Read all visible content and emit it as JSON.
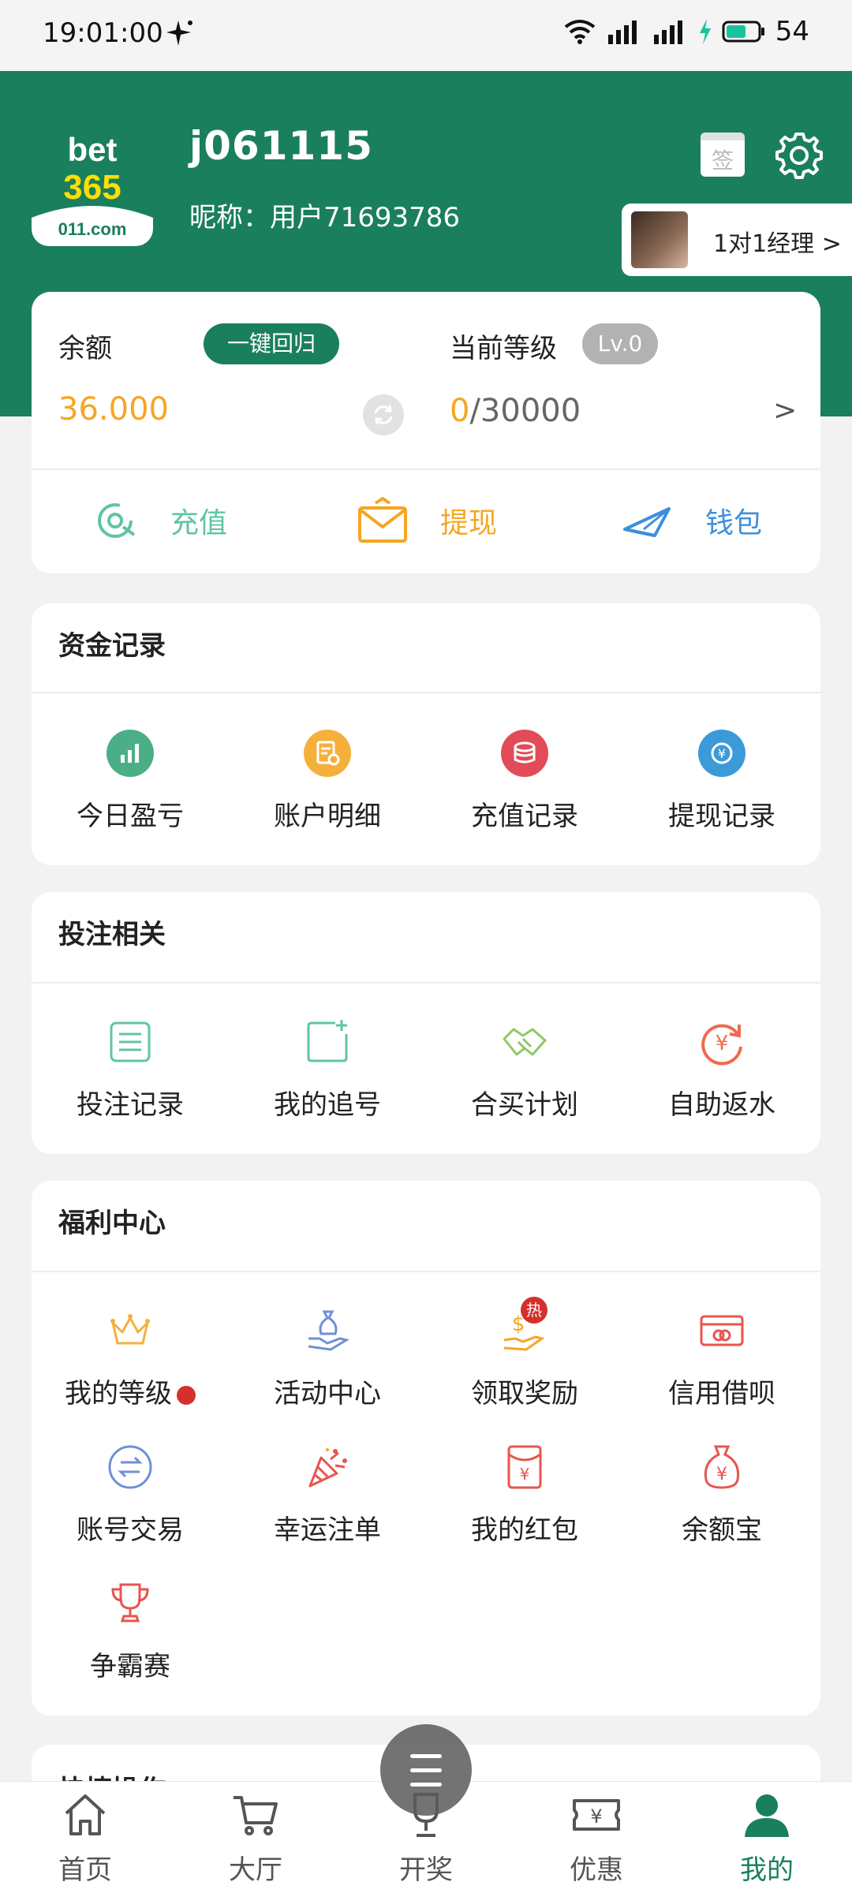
{
  "status_bar": {
    "time": "19:01:00",
    "battery": "54"
  },
  "header": {
    "logo": {
      "line1": "bet",
      "line2": "365",
      "line3": "011.com"
    },
    "username": "j061115",
    "nickname": "昵称：用户71693786",
    "sign_label": "签",
    "manager_label": "1对1经理 >"
  },
  "balance": {
    "label": "余额",
    "return_button": "一键回归",
    "amount": "36.000",
    "level_label": "当前等级",
    "level_badge": "Lv.0",
    "progress_current": "0",
    "progress_total": "/30000",
    "arrow": ">",
    "actions": [
      {
        "label": "充值",
        "color": "#5fc4a6",
        "icon": "recharge-icon"
      },
      {
        "label": "提现",
        "color": "#f5a623",
        "icon": "withdraw-icon"
      },
      {
        "label": "钱包",
        "color": "#3d8fdc",
        "icon": "wallet-icon"
      }
    ]
  },
  "funds": {
    "title": "资金记录",
    "items": [
      "今日盈亏",
      "账户明细",
      "充值记录",
      "提现记录"
    ]
  },
  "betting": {
    "title": "投注相关",
    "items": [
      "投注记录",
      "我的追号",
      "合买计划",
      "自助返水"
    ]
  },
  "welfare": {
    "title": "福利中心",
    "hot_badge": "热",
    "items": [
      "我的等级",
      "活动中心",
      "领取奖励",
      "信用借呗",
      "账号交易",
      "幸运注单",
      "我的红包",
      "余额宝",
      "争霸赛"
    ]
  },
  "quick": {
    "title": "快捷操作"
  },
  "bottom_nav": {
    "items": [
      "首页",
      "大厅",
      "开奖",
      "优惠",
      "我的"
    ],
    "active_index": 4
  },
  "colors": {
    "brand_green": "#1a7f5c",
    "orange": "#f5a623",
    "red": "#d6302c"
  }
}
